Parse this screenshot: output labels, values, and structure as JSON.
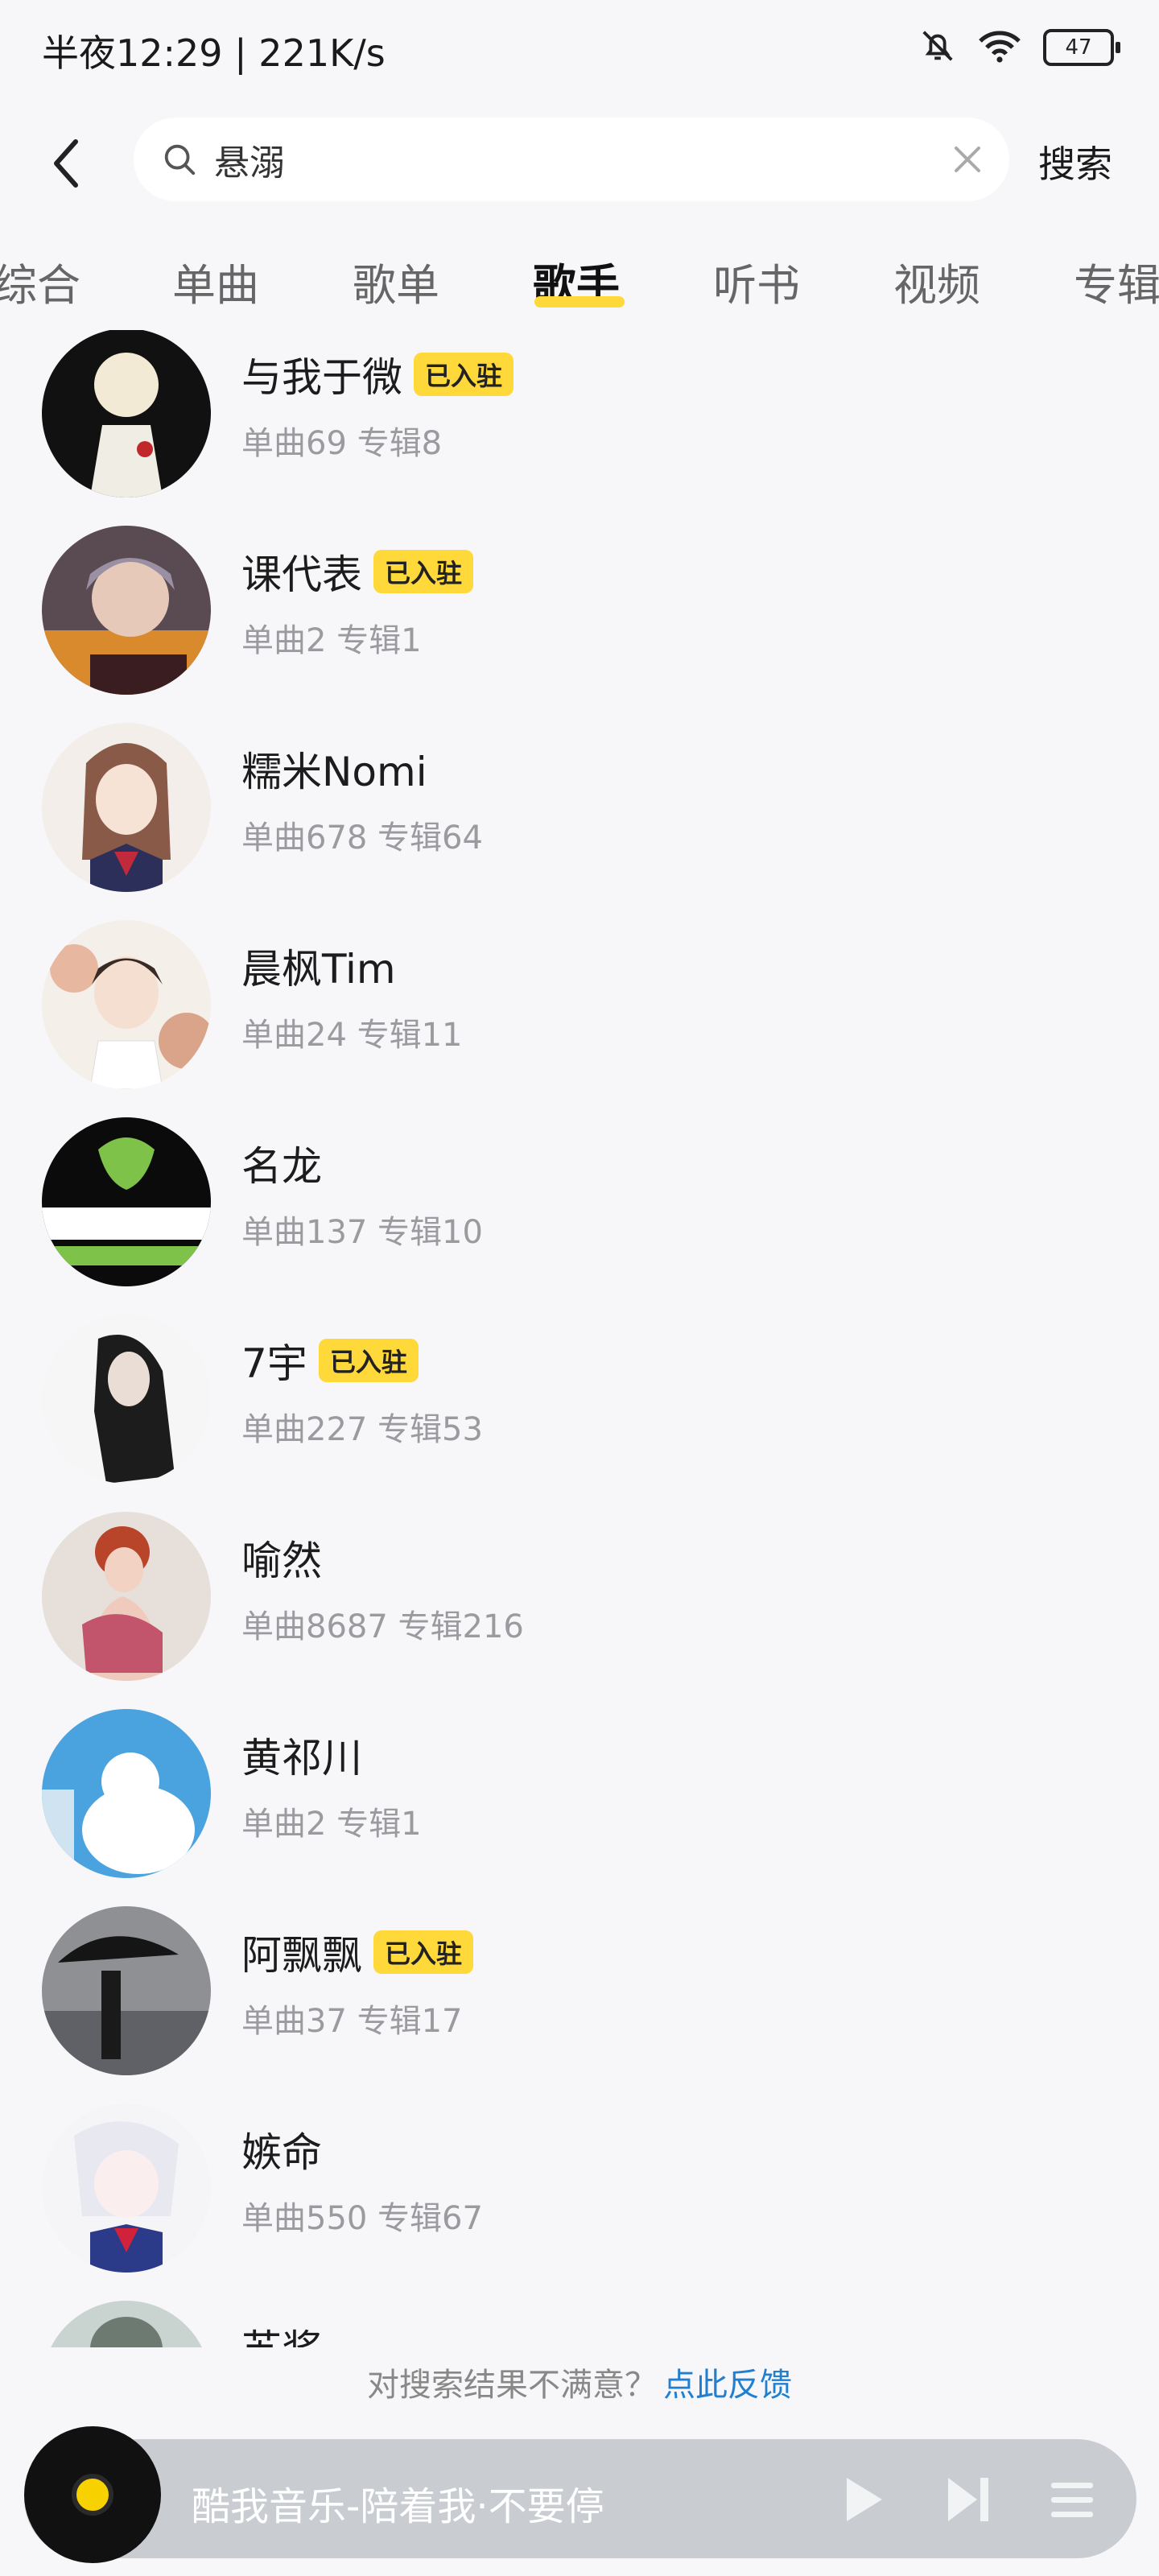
{
  "status": {
    "time_speed": "半夜12:29 | 221K/s",
    "battery": "47"
  },
  "search": {
    "query": "悬溺",
    "submit_label": "搜索"
  },
  "tabs": [
    "综合",
    "单曲",
    "歌单",
    "歌手",
    "听书",
    "视频",
    "专辑"
  ],
  "active_tab": "歌手",
  "artists": [
    {
      "name": "与我于微",
      "badge": "已入驻",
      "stats": "单曲69 专辑8"
    },
    {
      "name": "课代表",
      "badge": "已入驻",
      "stats": "单曲2 专辑1"
    },
    {
      "name": "糯米Nomi",
      "badge": "",
      "stats": "单曲678 专辑64"
    },
    {
      "name": "晨枫Tim",
      "badge": "",
      "stats": "单曲24 专辑11"
    },
    {
      "name": "名龙",
      "badge": "",
      "stats": "单曲137 专辑10"
    },
    {
      "name": "7宇",
      "badge": "已入驻",
      "stats": "单曲227 专辑53"
    },
    {
      "name": "喻然",
      "badge": "",
      "stats": "单曲8687 专辑216"
    },
    {
      "name": "黄祁川",
      "badge": "",
      "stats": "单曲2 专辑1"
    },
    {
      "name": "阿飘飘",
      "badge": "已入驻",
      "stats": "单曲37 专辑17"
    },
    {
      "name": "嫉命",
      "badge": "",
      "stats": "单曲550 专辑67"
    },
    {
      "name": "苏浆",
      "badge": "",
      "stats": ""
    }
  ],
  "feedback": {
    "text": "对搜索结果不满意？",
    "link": "点此反馈"
  },
  "player": {
    "title": "酷我音乐-陪着我·不要停"
  },
  "colors": {
    "accent": "#ffd83a",
    "link": "#1f7fd1",
    "background": "#f7f7f9"
  }
}
